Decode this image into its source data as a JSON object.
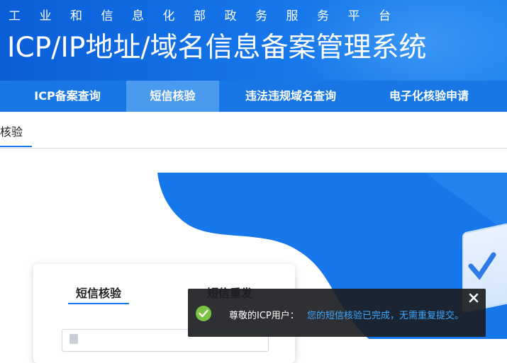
{
  "header": {
    "ministry": "工业和信息化部政务服务平台",
    "system_title": "ICP/IP地址/域名信息备案管理系统"
  },
  "nav": {
    "items": [
      {
        "label": "ICP备案查询"
      },
      {
        "label": "短信核验"
      },
      {
        "label": "违法违规域名查询"
      },
      {
        "label": "电子化核验申请"
      }
    ]
  },
  "subtab": {
    "label": "核验"
  },
  "card": {
    "tabs": [
      {
        "label": "短信核验"
      },
      {
        "label": "短信重发"
      }
    ]
  },
  "toast": {
    "lead": "尊敬的ICP用户：",
    "message": "您的短信核验已完成，无需重复提交。",
    "icon": "check-circle-icon",
    "close_icon": "close-icon"
  },
  "colors": {
    "header_blue": "#0a5ed8",
    "nav_blue": "#1777e6",
    "nav_active": "#4a9af0",
    "success_green": "#7cc242",
    "toast_link": "#3ba8ff"
  }
}
